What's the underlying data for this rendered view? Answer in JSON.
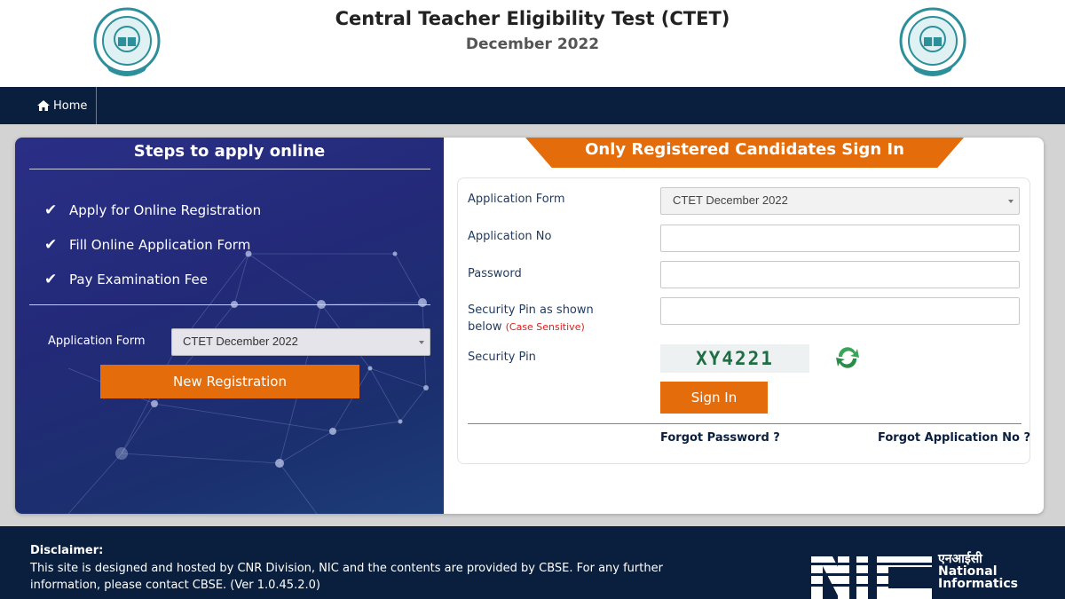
{
  "header": {
    "title": "Central Teacher Eligibility Test (CTET)",
    "subtitle": "December 2022"
  },
  "nav": {
    "home_label": "Home"
  },
  "left_panel": {
    "title": "Steps to apply online",
    "steps": [
      "Apply for Online Registration",
      "Fill Online Application Form",
      "Pay Examination Fee"
    ],
    "application_form_label": "Application Form",
    "application_form_value": "CTET December 2022",
    "new_registration_label": "New Registration"
  },
  "sign_in": {
    "banner": "Only Registered Candidates Sign In",
    "application_form_label": "Application Form",
    "application_form_value": "CTET December 2022",
    "application_no_label": "Application No",
    "application_no_value": "",
    "password_label": "Password",
    "password_value": "",
    "security_pin_shown_label_1": "Security Pin as shown",
    "security_pin_shown_label_2": "below",
    "case_sensitive": "(Case Sensitive)",
    "security_pin_value": "",
    "security_pin_label": "Security Pin",
    "captcha_text": "XY4221",
    "sign_in_label": "Sign In",
    "forgot_password": "Forgot Password ?",
    "forgot_application_no": "Forgot Application No ?"
  },
  "footer": {
    "disclaimer_heading": "Disclaimer:",
    "disclaimer_line_1": "This site is designed and hosted by CNR Division, NIC and the contents are provided by CBSE. For any further",
    "disclaimer_line_2": "information, please contact CBSE. (Ver 1.0.45.2.0)",
    "nic_hindi": "एनआईसी",
    "nic_line_1": "National",
    "nic_line_2": "Informatics"
  },
  "icons": {
    "home": "home-icon",
    "check": "check-icon",
    "refresh": "refresh-icon",
    "logo": "cbse-emblem-logo"
  },
  "colors": {
    "navy": "#0a1f3d",
    "orange": "#e46c0a",
    "panel_blue": "#232a78"
  }
}
